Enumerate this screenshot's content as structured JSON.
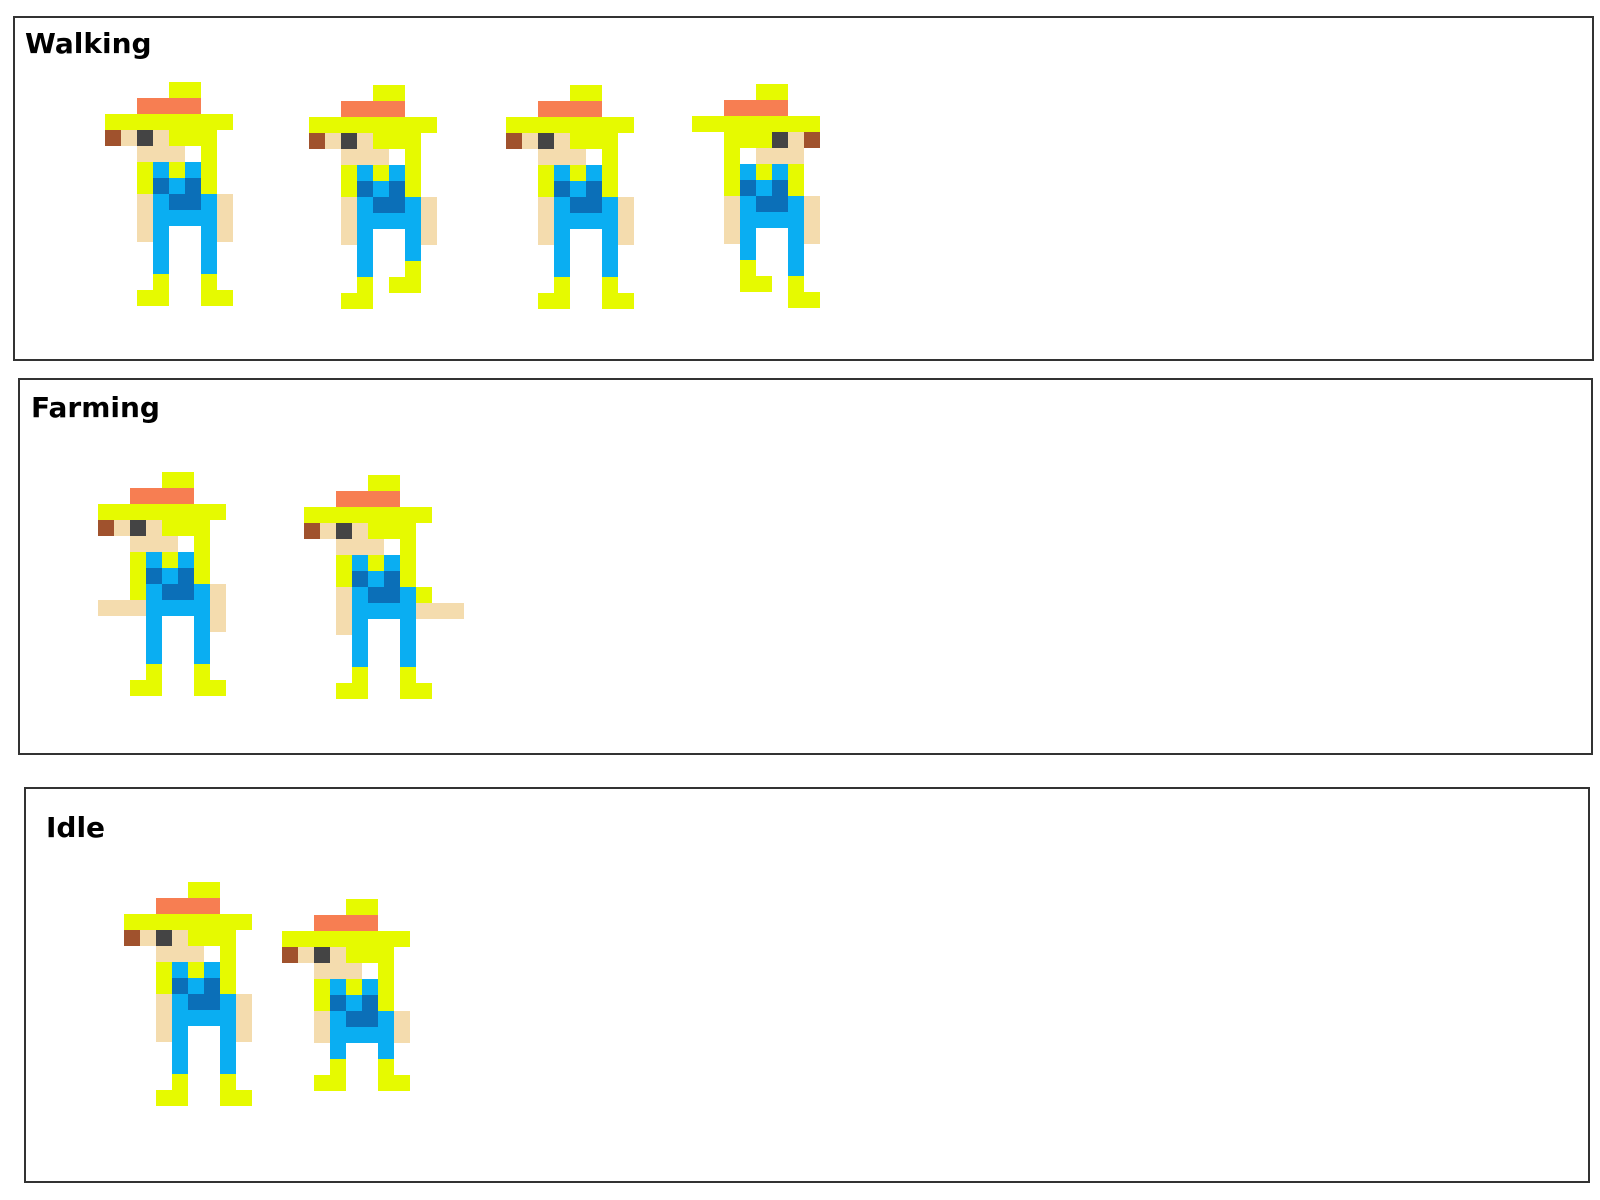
{
  "palette": {
    "hat": "#e6fa00",
    "hat_band": "#f77e52",
    "hair": "#a0522d",
    "skin": "#f4dcae",
    "eye": "#444444",
    "overalls": "#0aaef2",
    "overalls_dark": "#0b6fb8",
    "border": "#333333",
    "background": "#ffffff"
  },
  "sections": [
    {
      "title": "Walking",
      "frames": [
        {
          "pose": "walk-step-a"
        },
        {
          "pose": "walk-step-b"
        },
        {
          "pose": "walk-step-a"
        },
        {
          "pose": "walk-step-c-facing-right"
        }
      ]
    },
    {
      "title": "Farming",
      "frames": [
        {
          "pose": "farm-arm-left"
        },
        {
          "pose": "farm-arm-right"
        }
      ]
    },
    {
      "title": "Idle",
      "frames": [
        {
          "pose": "idle-tall"
        },
        {
          "pose": "idle-crouch"
        }
      ]
    }
  ]
}
